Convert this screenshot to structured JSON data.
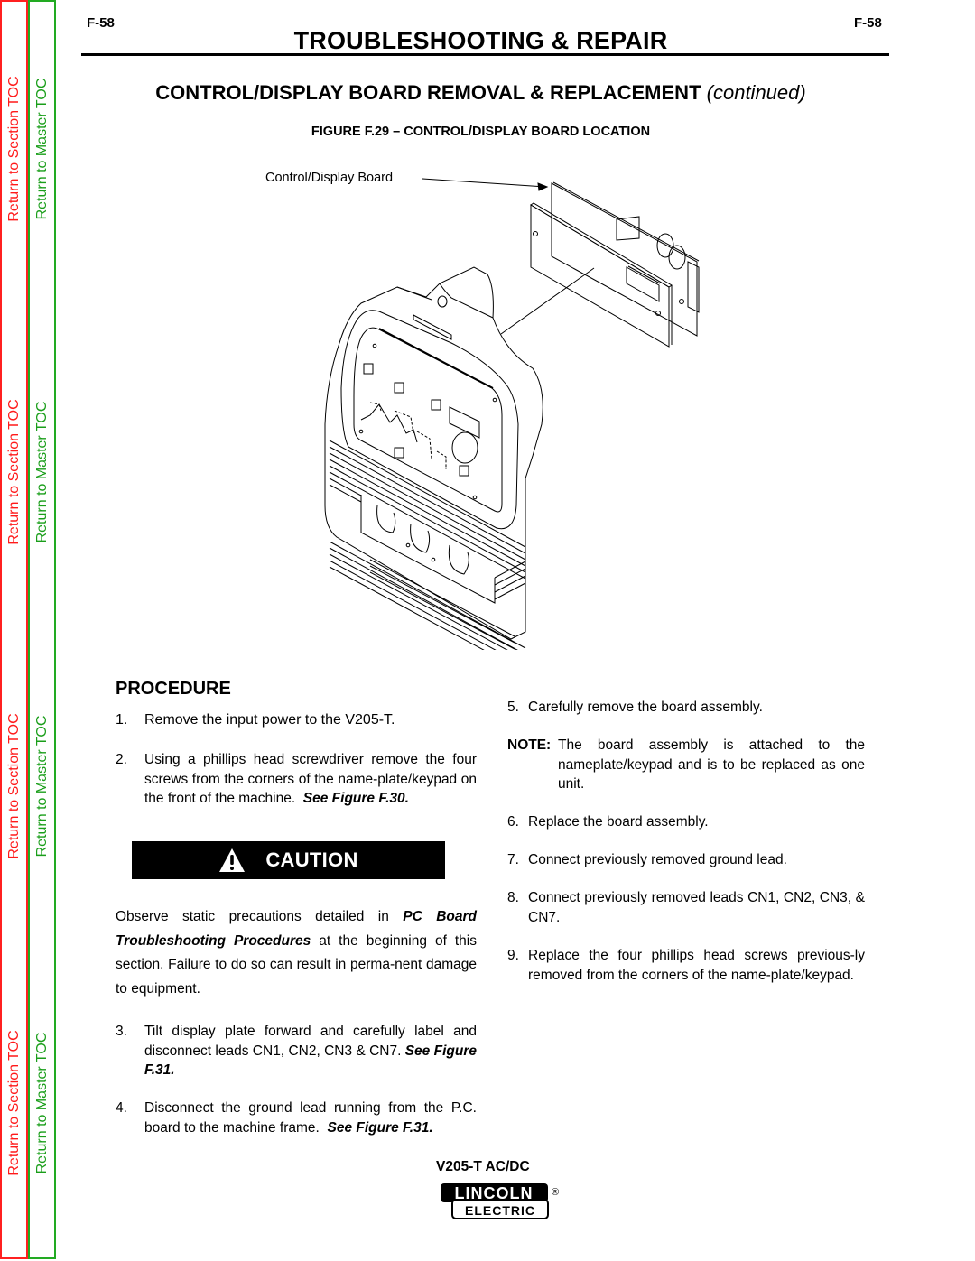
{
  "toc": {
    "section_label": "Return to Section TOC",
    "master_label": "Return to Master TOC",
    "colors": {
      "section": "#ff1a1a",
      "master": "#1a9e1a"
    }
  },
  "header": {
    "page_number_left": "F-58",
    "page_number_right": "F-58",
    "section_title": "TROUBLESHOOTING & REPAIR"
  },
  "heading": {
    "title": "CONTROL/DISPLAY BOARD REMOVAL & REPLACEMENT",
    "continued": "(continued)"
  },
  "figure": {
    "caption": "FIGURE F.29 – CONTROL/DISPLAY BOARD LOCATION",
    "callout": "Control/Display Board"
  },
  "procedure": {
    "heading": "PROCEDURE",
    "steps": [
      {
        "num": "1.",
        "text": "Remove the input power to the V205-T."
      },
      {
        "num": "2.",
        "text": "Using a phillips head screwdriver remove the four screws from the corners of the name-plate/keypad on the front of the machine.",
        "ref": "See Figure F.30."
      },
      {
        "num": "3.",
        "text": "Tilt display plate forward and carefully label and disconnect leads CN1, CN2, CN3 & CN7.",
        "ref": "See Figure F.31."
      },
      {
        "num": "4.",
        "text": "Disconnect the ground lead running from the P.C. board to the machine frame.",
        "ref": "See Figure F.31."
      },
      {
        "num": "5.",
        "text": "Carefully remove the board assembly."
      },
      {
        "num": "6.",
        "text": "Replace the board assembly."
      },
      {
        "num": "7.",
        "text": "Connect previously removed ground lead."
      },
      {
        "num": "8.",
        "text": "Connect previously removed leads CN1,  CN2, CN3, & CN7."
      },
      {
        "num": "9.",
        "text": "Replace the four phillips head screws previous-ly removed from the corners of the name-plate/keypad."
      }
    ],
    "note": {
      "label": "NOTE:",
      "text": "The board assembly is attached to the nameplate/keypad and is to be replaced as one unit."
    }
  },
  "caution": {
    "label": "CAUTION",
    "icon": "warning-triangle-icon",
    "text_before": "Observe static precautions detailed in ",
    "text_ref": "PC Board Troubleshooting Procedures",
    "text_after": " at the beginning of this section.  Failure to do so can result in perma-nent damage to equipment."
  },
  "footer": {
    "model": "V205-T AC/DC",
    "brand_top": "LINCOLN",
    "brand_bottom": "ELECTRIC",
    "registered": "®"
  }
}
